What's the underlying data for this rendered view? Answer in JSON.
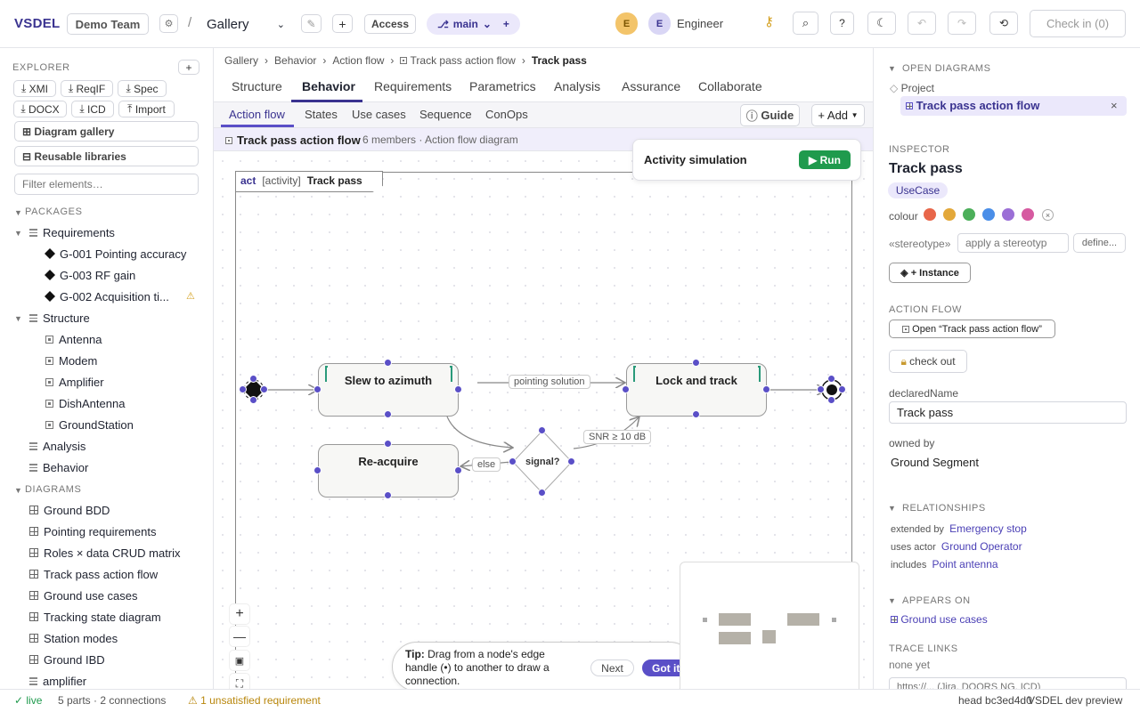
{
  "header": {
    "brand": "VSDEL",
    "team": "Demo Team",
    "separator": "/",
    "view_select": "Gallery",
    "access_label": "Access",
    "branch": "main",
    "avatar1": "E",
    "avatar2": "E",
    "user_role": "Engineer",
    "checkin_label": "Check in (0)"
  },
  "explorer": {
    "title": "EXPLORER",
    "export_buttons": [
      "XMI",
      "ReqIF",
      "Spec",
      "DOCX",
      "ICD",
      "Import"
    ],
    "gallery_button": "Diagram gallery",
    "libraries_button": "Reusable libraries",
    "filter_placeholder": "Filter elements…",
    "packages_title": "PACKAGES",
    "requirements_label": "Requirements",
    "requirements": [
      "G-001 Pointing accuracy",
      "G-003 RF gain",
      "G-002 Acquisition ti..."
    ],
    "structure_label": "Structure",
    "structure": [
      "Antenna",
      "Modem",
      "Amplifier",
      "DishAntenna",
      "GroundStation"
    ],
    "analysis_label": "Analysis",
    "behavior_label": "Behavior",
    "diagrams_title": "DIAGRAMS",
    "diagrams": [
      "Ground BDD",
      "Pointing requirements",
      "Roles × data CRUD matrix",
      "Track pass action flow",
      "Ground use cases",
      "Tracking state diagram",
      "Station modes",
      "Ground IBD"
    ],
    "cut_item": "amplifier"
  },
  "breadcrumb": [
    "Gallery",
    "Behavior",
    "Action flow",
    "Track pass action flow",
    "Track pass"
  ],
  "tabs": [
    "Structure",
    "Behavior",
    "Requirements",
    "Parametrics",
    "Analysis",
    "Assurance",
    "Collaborate"
  ],
  "subtabs": [
    "Action flow",
    "States",
    "Use cases",
    "Sequence",
    "ConOps"
  ],
  "guide_label": "Guide",
  "add_label": "+ Add",
  "diagram_bar": {
    "title": "Track pass action flow",
    "meta": "6 members · Action flow diagram"
  },
  "frame": {
    "kind": "act",
    "stereo": "[activity]",
    "name": "Track pass"
  },
  "simulation": {
    "title": "Activity simulation",
    "run_label": "Run"
  },
  "nodes": {
    "slew": "Slew to azimuth",
    "lock": "Lock and track",
    "reacquire": "Re-acquire",
    "decision": "signal?"
  },
  "edges": {
    "pointing": "pointing solution",
    "snr": "SNR ≥ 10 dB",
    "else": "else"
  },
  "tip": {
    "bold": "Tip:",
    "text": "Drag from a node's edge handle (•) to another to draw a connection.",
    "next": "Next",
    "gotit": "Got it"
  },
  "right": {
    "open_title": "OPEN DIAGRAMS",
    "project": "Project",
    "open_item": "Track pass action flow",
    "inspector_title": "INSPECTOR",
    "name": "Track pass",
    "kind": "UseCase",
    "colour_label": "colour",
    "colours": [
      "#e8664a",
      "#e3a83a",
      "#4caf5a",
      "#4a8ee8",
      "#9b6fd6",
      "#d65aa0"
    ],
    "stereotype_label": "«stereotype»",
    "stereotype_placeholder": "apply a stereotyp",
    "define_label": "define...",
    "instance_label": "+ Instance",
    "action_flow_title": "ACTION FLOW",
    "open_flow": "Open “Track pass action flow”",
    "checkout": "check out",
    "declared_label": "declaredName",
    "declared_value": "Track pass",
    "owned_label": "owned by",
    "owned_value": "Ground Segment",
    "rel_title": "RELATIONSHIPS",
    "rels": [
      {
        "kind": "extended by",
        "target": "Emergency stop"
      },
      {
        "kind": "uses actor",
        "target": "Ground Operator"
      },
      {
        "kind": "includes",
        "target": "Point antenna"
      }
    ],
    "appears_title": "APPEARS ON",
    "appears_item": "Ground use cases",
    "trace_title": "TRACE LINKS",
    "trace_none": "none yet",
    "trace_placeholder": "https://... (Jira, DOORS NG, ICD)"
  },
  "status": {
    "live": "live",
    "counts": "5 parts · 2 connections",
    "warning": "1 unsatisfied requirement",
    "head": "head bc3ed4d0",
    "preview": "VSDEL dev preview"
  }
}
